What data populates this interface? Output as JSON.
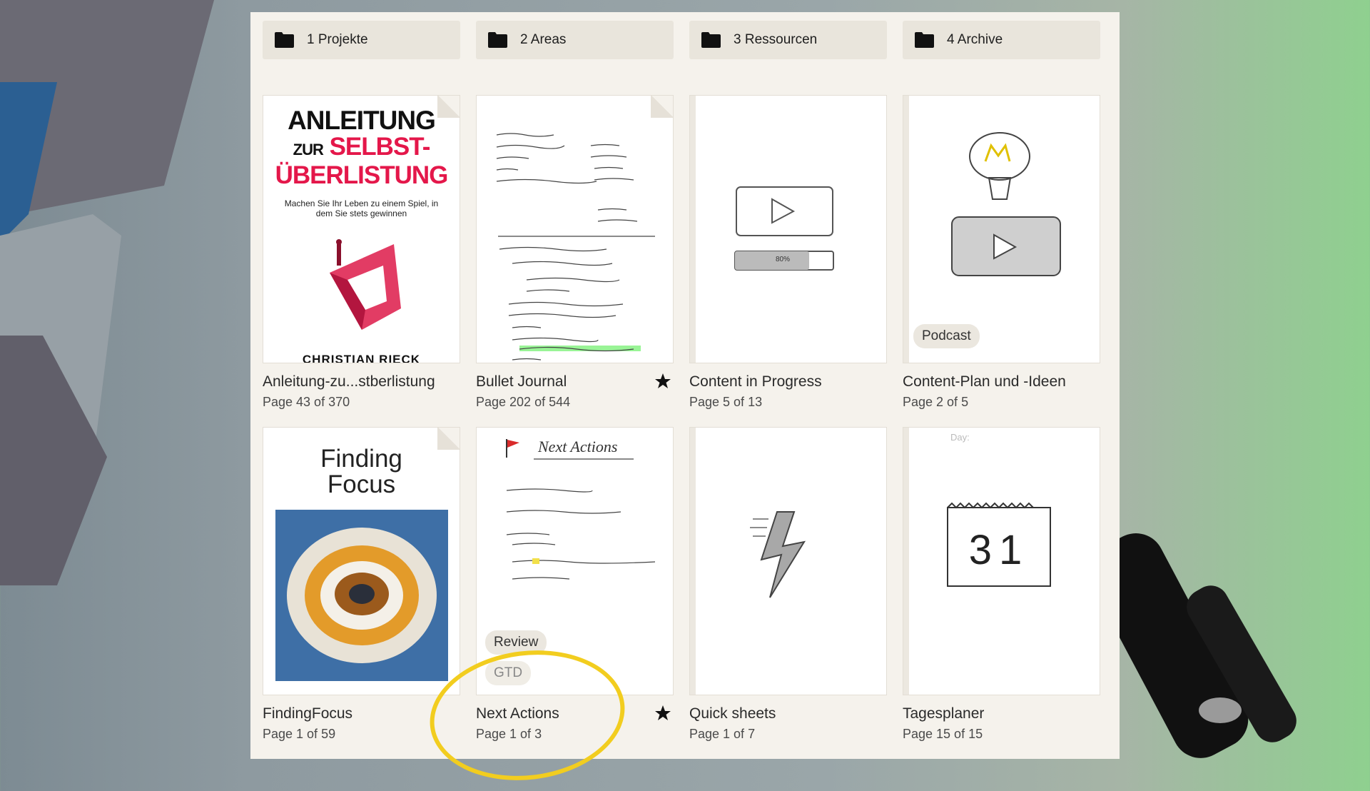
{
  "folders": [
    {
      "label": "1 Projekte"
    },
    {
      "label": "2 Areas"
    },
    {
      "label": "3 Ressourcen"
    },
    {
      "label": "4 Archive"
    }
  ],
  "notebooks": [
    {
      "title": "Anleitung-zu...stberlistung",
      "pages": "Page 43 of 370",
      "starred": false
    },
    {
      "title": "Bullet Journal",
      "pages": "Page 202 of 544",
      "starred": true
    },
    {
      "title": "Content in Progress",
      "pages": "Page 5 of 13",
      "starred": false
    },
    {
      "title": "Content-Plan und -Ideen",
      "pages": "Page 2 of 5",
      "starred": false,
      "tag": "Podcast"
    },
    {
      "title": "FindingFocus",
      "pages": "Page 1 of 59",
      "starred": false
    },
    {
      "title": "Next Actions",
      "pages": "Page 1 of 3",
      "starred": true,
      "tag": "Review",
      "tag2": "GTD"
    },
    {
      "title": "Quick sheets",
      "pages": "Page 1 of 7",
      "starred": false
    },
    {
      "title": "Tagesplaner",
      "pages": "Page 15 of 15",
      "starred": false
    }
  ],
  "covers": {
    "anleitung": {
      "line1": "ANLEITUNG",
      "line2_small": "ZUR",
      "line2": "SELBST-",
      "line3": "ÜBERLISTUNG",
      "subtitle": "Machen Sie Ihr Leben zu einem Spiel, in dem Sie stets gewinnen",
      "author": "CHRISTIAN RIECK"
    },
    "findingfocus": {
      "title": "Finding Focus"
    },
    "next_actions": {
      "heading": "Next Actions"
    },
    "content_progress": {
      "progress_label": "80%"
    },
    "tagesplaner": {
      "day_label": "Day:",
      "date": "31"
    }
  },
  "colors": {
    "panel": "#f5f2ec",
    "folder_bg": "#e9e5dc",
    "accent_red": "#e4174a",
    "highlight_circle": "#f2cd1f"
  },
  "icons": {
    "folder": "folder-icon",
    "star": "star-icon"
  }
}
